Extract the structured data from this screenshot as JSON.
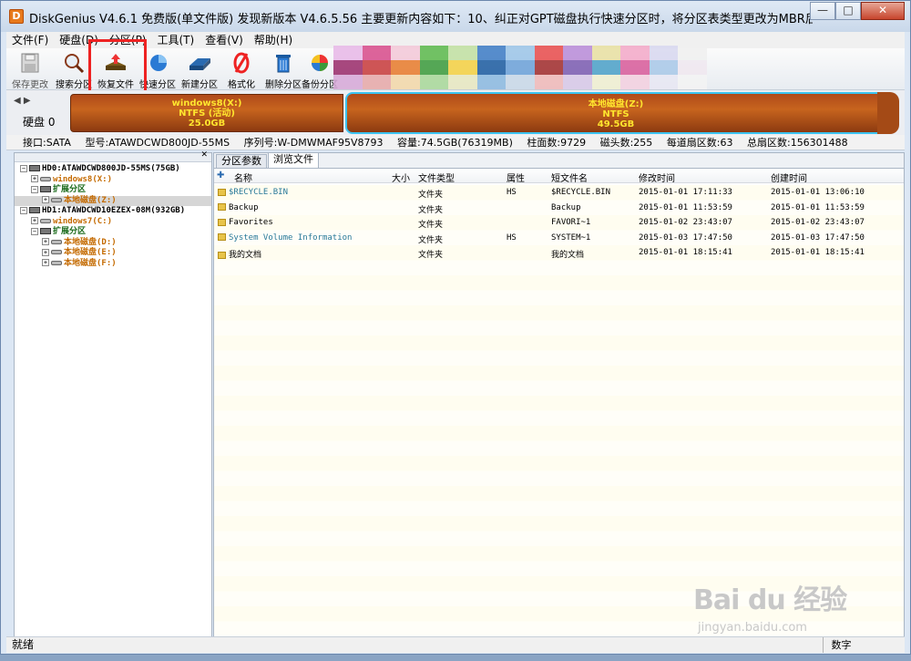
{
  "window": {
    "title": "DiskGenius V4.6.1 免费版(单文件版)  发现新版本 V4.6.5.56 主要更新内容如下：10、纠正对GPT磁盘执行快速分区时，将分区表类型更改为MBR后第一个分区未...",
    "icon_letter": "D",
    "minimize": "—",
    "maximize": "□",
    "close": "✕"
  },
  "menu": [
    "文件(F)",
    "硬盘(D)",
    "分区(P)",
    "工具(T)",
    "查看(V)",
    "帮助(H)"
  ],
  "toolbar": [
    {
      "label": "保存更改",
      "icon": "save-icon"
    },
    {
      "label": "搜索分区",
      "icon": "magnifier-icon"
    },
    {
      "label": "恢复文件",
      "icon": "recover-icon"
    },
    {
      "label": "快速分区",
      "icon": "quick-partition-icon"
    },
    {
      "label": "新建分区",
      "icon": "new-partition-icon"
    },
    {
      "label": "格式化",
      "icon": "format-icon"
    },
    {
      "label": "删除分区",
      "icon": "trash-icon"
    },
    {
      "label": "备份分区",
      "icon": "backup-icon"
    }
  ],
  "diskmap": {
    "disk_label": "硬盘 0",
    "partitions": [
      {
        "name": "windows8(X:)",
        "fs": "NTFS (活动)",
        "size": "25.0GB"
      },
      {
        "name": "本地磁盘(Z:)",
        "fs": "NTFS",
        "size": "49.5GB"
      }
    ]
  },
  "info": {
    "interface": "接口:SATA",
    "model": "型号:ATAWDCWD800JD-55MS",
    "serial": "序列号:W-DMWMAF95V8793",
    "capacity": "容量:74.5GB(76319MB)",
    "cylinders": "柱面数:9729",
    "heads": "磁头数:255",
    "sectors_per_track": "每道扇区数:63",
    "total_sectors": "总扇区数:156301488"
  },
  "tree": [
    {
      "level": 0,
      "type": "disk",
      "label": "HD0:ATAWDCWD800JD-55MS(75GB)",
      "exp": "−"
    },
    {
      "level": 1,
      "type": "part",
      "label": "windows8(X:)",
      "exp": "+"
    },
    {
      "level": 1,
      "type": "ext",
      "label": "扩展分区",
      "exp": "−"
    },
    {
      "level": 2,
      "type": "part",
      "label": "本地磁盘(Z:)",
      "exp": "+",
      "selected": true
    },
    {
      "level": 0,
      "type": "disk",
      "label": "HD1:ATAWDCWD10EZEX-08M(932GB)",
      "exp": "−"
    },
    {
      "level": 1,
      "type": "part",
      "label": "windows7(C:)",
      "exp": "+"
    },
    {
      "level": 1,
      "type": "ext",
      "label": "扩展分区",
      "exp": "−"
    },
    {
      "level": 2,
      "type": "part",
      "label": "本地磁盘(D:)",
      "exp": "+"
    },
    {
      "level": 2,
      "type": "part",
      "label": "本地磁盘(E:)",
      "exp": "+"
    },
    {
      "level": 2,
      "type": "part",
      "label": "本地磁盘(F:)",
      "exp": "+"
    }
  ],
  "tabs": [
    "分区参数",
    "浏览文件"
  ],
  "columns": [
    "名称",
    "大小",
    "文件类型",
    "属性",
    "短文件名",
    "修改时间",
    "创建时间"
  ],
  "files": [
    {
      "name": "$RECYCLE.BIN",
      "size": "",
      "type": "文件夹",
      "attr": "HS",
      "short": "$RECYCLE.BIN",
      "modified": "2015-01-01 17:11:33",
      "created": "2015-01-01 13:06:10",
      "color": "#2a7a9a"
    },
    {
      "name": "Backup",
      "size": "",
      "type": "文件夹",
      "attr": "",
      "short": "Backup",
      "modified": "2015-01-01 11:53:59",
      "created": "2015-01-01 11:53:59",
      "color": "#000000"
    },
    {
      "name": "Favorites",
      "size": "",
      "type": "文件夹",
      "attr": "",
      "short": "FAVORI~1",
      "modified": "2015-01-02 23:43:07",
      "created": "2015-01-02 23:43:07",
      "color": "#000000"
    },
    {
      "name": "System Volume Information",
      "size": "",
      "type": "文件夹",
      "attr": "HS",
      "short": "SYSTEM~1",
      "modified": "2015-01-03 17:47:50",
      "created": "2015-01-03 17:47:50",
      "color": "#2a7a9a"
    },
    {
      "name": "我的文档",
      "size": "",
      "type": "文件夹",
      "attr": "",
      "short": "我的文档",
      "modified": "2015-01-01 18:15:41",
      "created": "2015-01-01 18:15:41",
      "color": "#000000"
    }
  ],
  "status": {
    "left": "就绪",
    "right": "数字"
  },
  "watermark": {
    "logo": "Bai du 经验",
    "url": "jingyan.baidu.com"
  }
}
